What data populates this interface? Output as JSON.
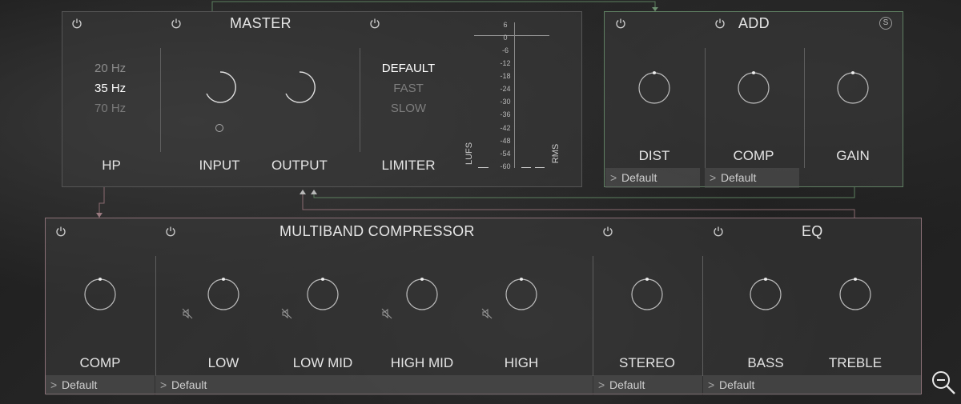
{
  "master": {
    "title": "MASTER",
    "hp": {
      "label": "HP",
      "options": [
        "20 Hz",
        "35 Hz",
        "70 Hz"
      ],
      "selected": "35 Hz"
    },
    "input_label": "INPUT",
    "output_label": "OUTPUT",
    "limiter": {
      "label": "LIMITER",
      "options": [
        "DEFAULT",
        "FAST",
        "SLOW"
      ],
      "selected": "DEFAULT"
    },
    "meter": {
      "ticks": [
        "6",
        "0",
        "-6",
        "-12",
        "-18",
        "-24",
        "-30",
        "-36",
        "-42",
        "-48",
        "-54",
        "-60"
      ],
      "left_label": "LUFS",
      "right_label": "RMS"
    }
  },
  "add": {
    "title": "ADD",
    "dist_label": "DIST",
    "comp_label": "COMP",
    "gain_label": "GAIN",
    "solo_glyph": "S",
    "dist_preset": "Default",
    "comp_preset": "Default"
  },
  "multiband": {
    "title": "MULTIBAND COMPRESSOR",
    "comp_label": "COMP",
    "comp_preset": "Default",
    "low_label": "LOW",
    "lowmid_label": "LOW MID",
    "highmid_label": "HIGH MID",
    "high_label": "HIGH",
    "bands_preset": "Default",
    "stereo_label": "STEREO",
    "stereo_preset": "Default"
  },
  "eq": {
    "title": "EQ",
    "bass_label": "BASS",
    "treble_label": "TREBLE",
    "preset": "Default"
  },
  "colors": {
    "hp_active": "#ffffff",
    "hp_inactive": "#8c8c8c",
    "limiter_inactive": "#7e7e7e",
    "add_border": "#5f7f62",
    "multiband_border": "#8a6f76",
    "knob_ring": "#bdbdbd",
    "knob_highlight": "#ffffff"
  }
}
